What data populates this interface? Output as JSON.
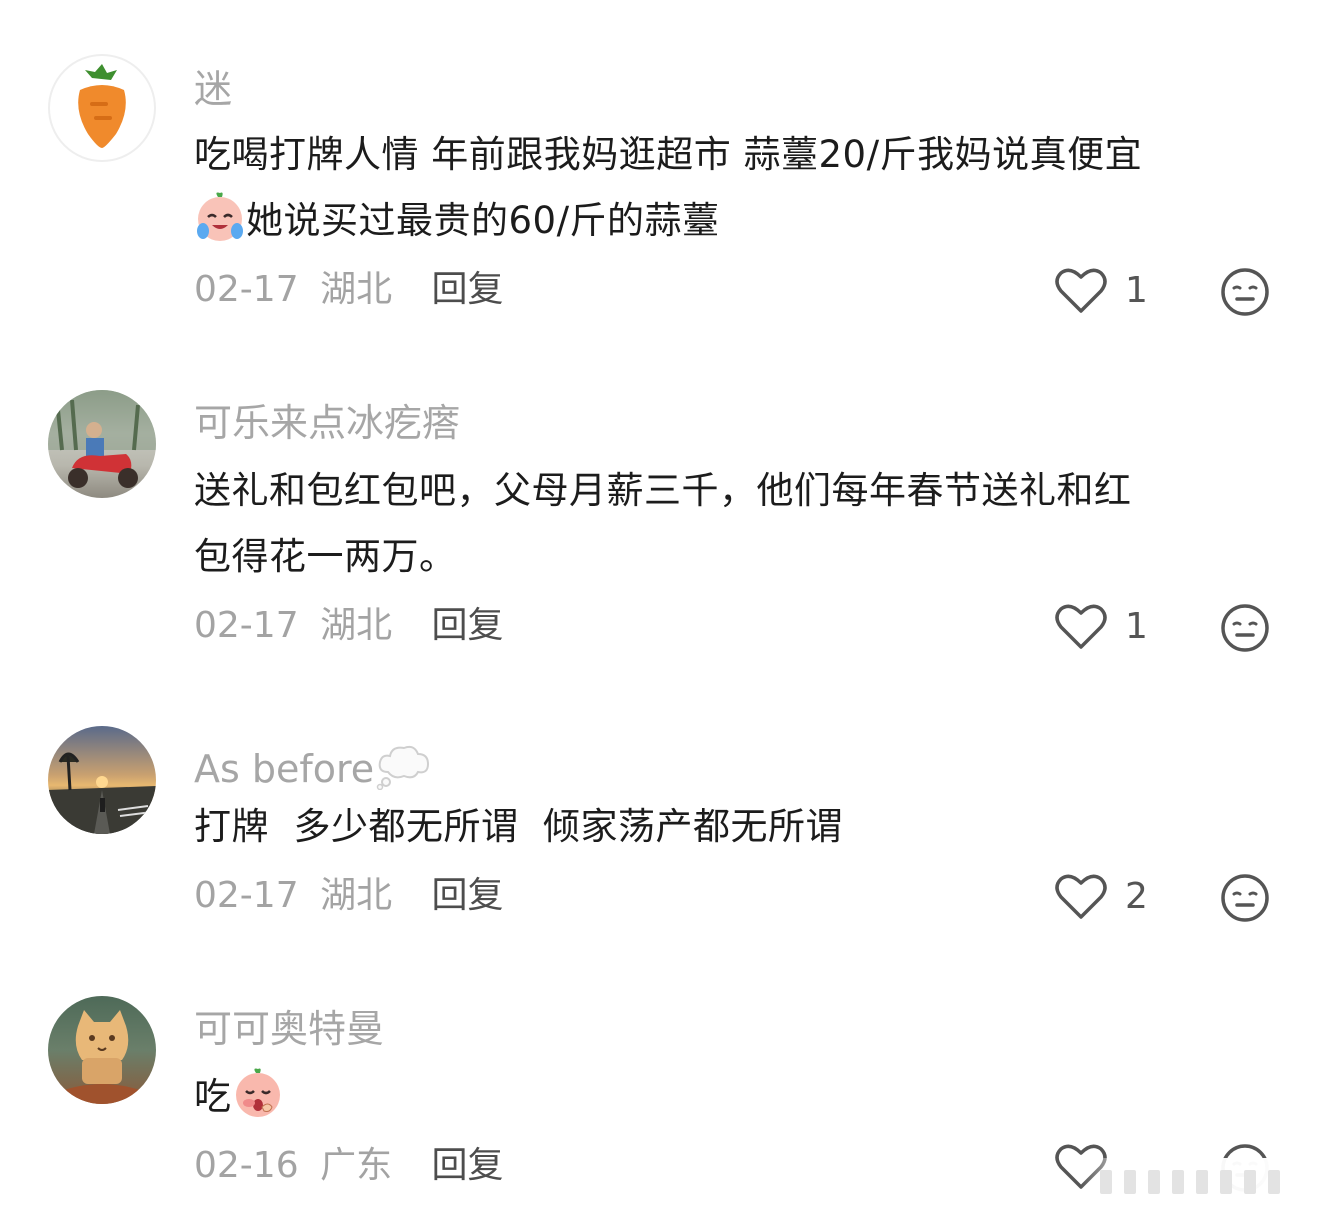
{
  "comments": [
    {
      "username": "迷",
      "content_lines": [
        "吃喝打牌人情 年前跟我妈逛超市 蒜薹20/斤我妈说真便宜",
        "她说买过最贵的60/斤的蒜薹"
      ],
      "date": "02-17",
      "location": "湖北",
      "reply": "回复",
      "likes": "1",
      "avatar": "carrot-avatar"
    },
    {
      "username": "可乐来点冰疙瘩",
      "content_lines": [
        "送礼和包红包吧，父母月薪三千，他们每年春节送礼和红",
        "包得花一两万。"
      ],
      "date": "02-17",
      "location": "湖北",
      "reply": "回复",
      "likes": "1",
      "avatar": "scooter-photo-avatar"
    },
    {
      "username": "As before",
      "content_lines": [
        "打牌  多少都无所谓  倾家荡产都无所谓"
      ],
      "date": "02-17",
      "location": "湖北",
      "reply": "回复",
      "likes": "2",
      "avatar": "sunset-road-avatar"
    },
    {
      "username": "可可奥特曼",
      "content_lines": [
        "吃"
      ],
      "date": "02-16",
      "location": "广东",
      "reply": "回复",
      "likes": "",
      "avatar": "cat-statue-avatar"
    }
  ],
  "colors": {
    "username": "#a6a6a6",
    "text": "#1c1c1c",
    "meta": "#a3a3a3",
    "reply": "#4d4d4d",
    "icon": "#555555"
  }
}
